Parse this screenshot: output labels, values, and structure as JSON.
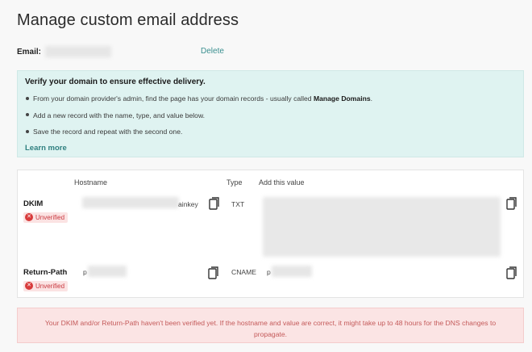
{
  "page": {
    "title": "Manage custom email address"
  },
  "email": {
    "label": "Email:",
    "separator": ":",
    "delete_label": "Delete"
  },
  "info": {
    "title": "Verify your domain to ensure effective delivery.",
    "step1_text": "From your domain provider's admin, find the page has your domain records - usually called ",
    "step1_bold": "Manage Domains",
    "step1_end": ".",
    "step2": "Add a new record with the name, type, and value below.",
    "step3": "Save the record and repeat with the second one.",
    "learn_more": "Learn more"
  },
  "table": {
    "headers": {
      "hostname": "Hostname",
      "type": "Type",
      "value": "Add this value"
    },
    "records": [
      {
        "name": "DKIM",
        "status": "Unverified",
        "host_suffix": "ainkey",
        "type": "TXT",
        "value_prefix": ""
      },
      {
        "name": "Return-Path",
        "status": "Unverified",
        "host_prefix": "p",
        "type": "CNAME",
        "value_prefix": "p"
      }
    ]
  },
  "warning": "Your DKIM and/or Return-Path haven't been verified yet. If the hostname and value are correct, it might take up to 48 hours for the DNS changes to propagate.",
  "colors": {
    "teal_link": "#3a8f8f",
    "info_bg": "#dff3f1",
    "error_red": "#d83b3b",
    "warning_bg": "#fbe4e4"
  },
  "icons": {
    "copy": "copy-icon",
    "status": "error-circle-icon"
  }
}
